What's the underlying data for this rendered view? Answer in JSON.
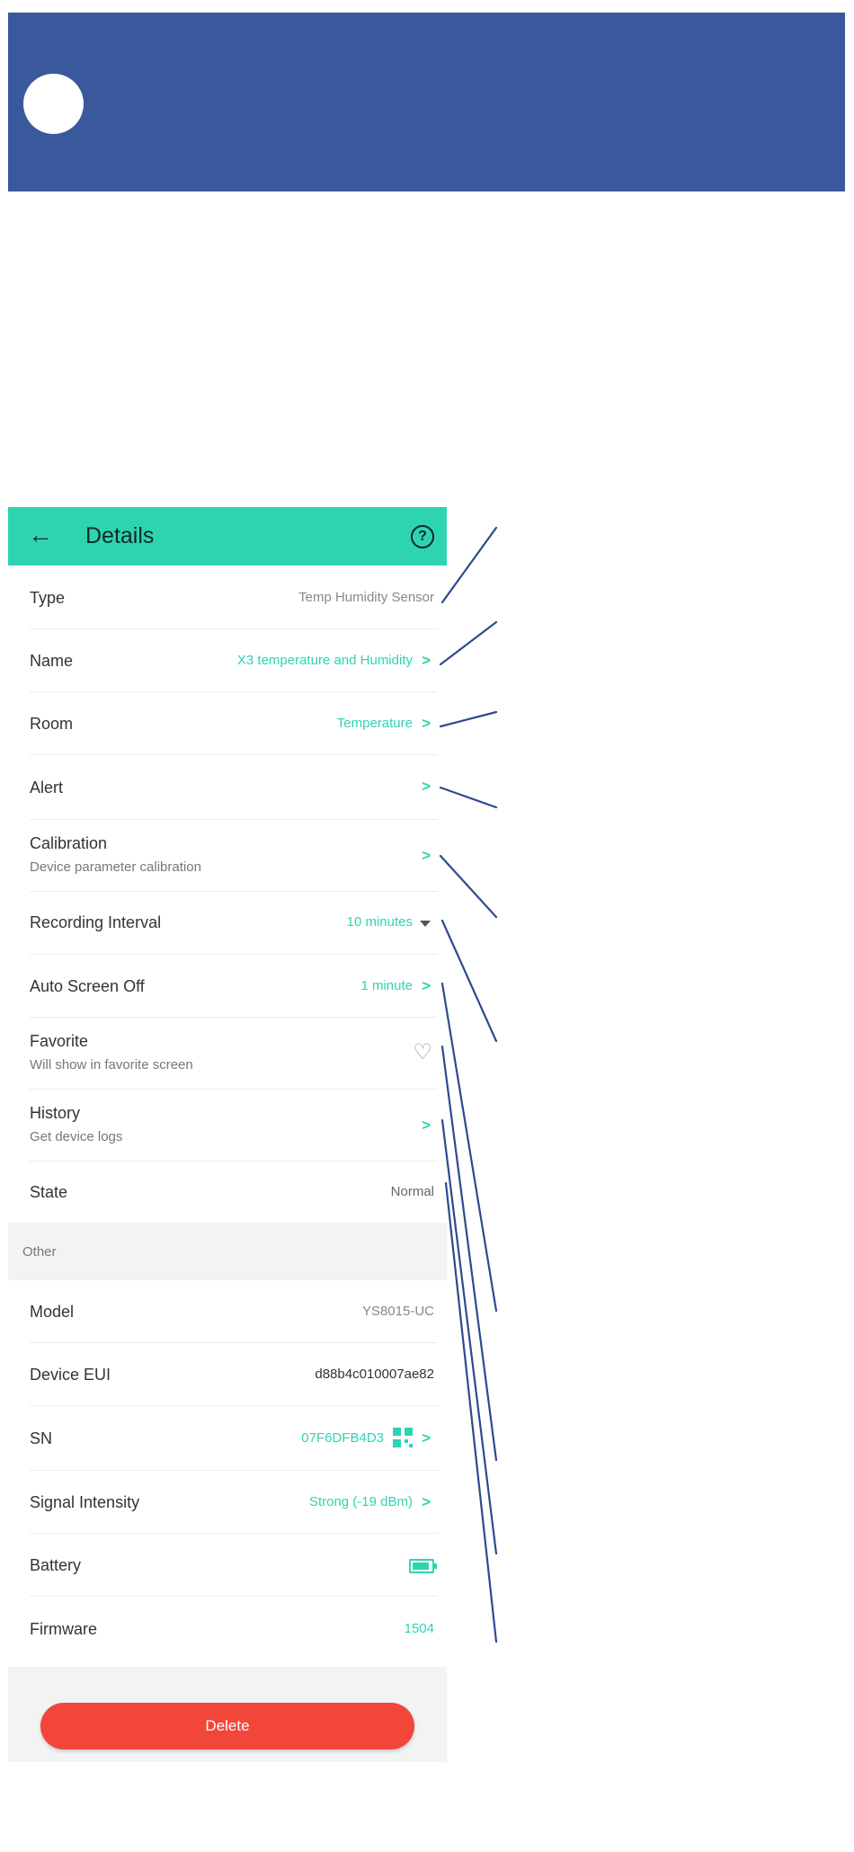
{
  "appbar": {
    "title": "Details",
    "back_icon": "arrow-left-icon",
    "help_icon": "question-circle-icon"
  },
  "rows": {
    "type": {
      "label": "Type",
      "value": "Temp Humidity Sensor"
    },
    "name": {
      "label": "Name",
      "value": "X3 temperature and Humidity"
    },
    "room": {
      "label": "Room",
      "value": "Temperature"
    },
    "alert": {
      "label": "Alert"
    },
    "calibration": {
      "label": "Calibration",
      "sub": "Device parameter calibration"
    },
    "recording": {
      "label": "Recording Interval",
      "value": "10 minutes"
    },
    "autoscreen": {
      "label": "Auto Screen Off",
      "value": "1 minute"
    },
    "favorite": {
      "label": "Favorite",
      "sub": "Will show in favorite screen"
    },
    "history": {
      "label": "History",
      "sub": "Get device logs"
    },
    "state": {
      "label": "State",
      "value": "Normal"
    }
  },
  "other_section": {
    "label": "Other"
  },
  "other_rows": {
    "model": {
      "label": "Model",
      "value": "YS8015-UC"
    },
    "eui": {
      "label": "Device EUI",
      "value": "d88b4c010007ae82"
    },
    "sn": {
      "label": "SN",
      "value": "07F6DFB4D3"
    },
    "signal": {
      "label": "Signal Intensity",
      "value": "Strong (-19 dBm)"
    },
    "battery": {
      "label": "Battery"
    },
    "firmware": {
      "label": "Firmware",
      "value": "1504"
    }
  },
  "footer": {
    "delete_label": "Delete"
  },
  "colors": {
    "accent": "#2ed4b0",
    "banner": "#3a599c",
    "delete": "#f2463a",
    "leader_lines": "#2c4a8f"
  }
}
